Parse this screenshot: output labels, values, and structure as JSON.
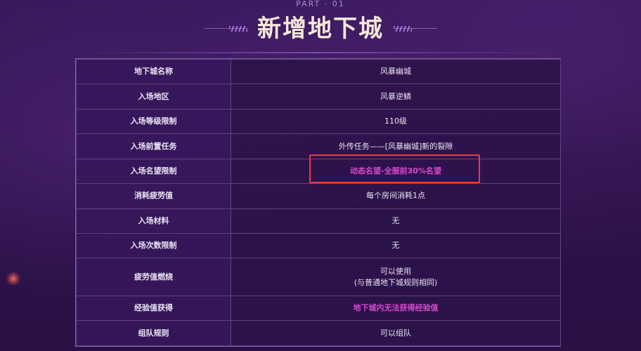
{
  "header": {
    "part_label": "PART · 01",
    "title": "新增地下城"
  },
  "table": {
    "rows": [
      {
        "label": "地下城名称",
        "value": "风暴幽城"
      },
      {
        "label": "入场地区",
        "value": "风暴逆鳞"
      },
      {
        "label": "入场等级限制",
        "value": "110级"
      },
      {
        "label": "入场前置任务",
        "value": "外传任务——[风暴幽城]新的裂隙"
      },
      {
        "label": "入场名望限制",
        "value": "动态名望-全服前30%名望"
      },
      {
        "label": "消耗疲劳值",
        "value": "每个房间消耗1点"
      },
      {
        "label": "入场材料",
        "value": "无"
      },
      {
        "label": "入场次数限制",
        "value": "无"
      },
      {
        "label": "疲劳值燃烧",
        "value_line1": "可以使用",
        "value_line2": "(与普通地下城规则相同)"
      },
      {
        "label": "经验值获得",
        "value": "地下城内无法获得经验值"
      },
      {
        "label": "组队规则",
        "value": "可以组队"
      }
    ]
  },
  "colors": {
    "background": "#2a1045",
    "title_text": "#f4ead9",
    "accent_pink": "#d64bcf",
    "highlight_red": "#ea3c40"
  }
}
